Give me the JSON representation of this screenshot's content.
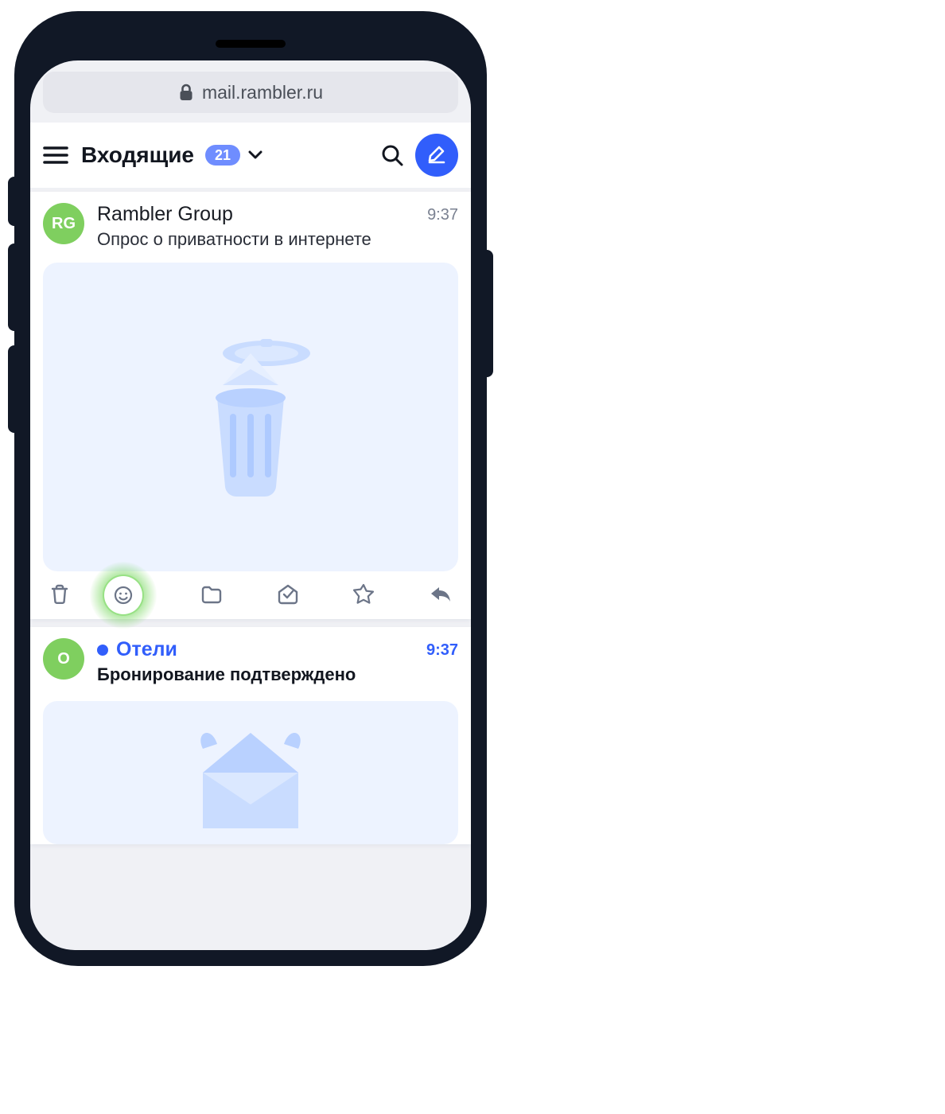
{
  "browser": {
    "url": "mail.rambler.ru"
  },
  "header": {
    "folder": "Входящие",
    "unread_count": "21"
  },
  "messages": [
    {
      "avatar_initials": "RG",
      "avatar_color": "green",
      "sender": "Rambler Group",
      "time": "9:37",
      "subject": "Опрос о приватности в интернете",
      "unread": false,
      "preview": "trash"
    },
    {
      "avatar_initials": "O",
      "avatar_color": "green",
      "sender": "Отели",
      "time": "9:37",
      "subject": "Бронирование подтверждено",
      "unread": true,
      "preview": "viking"
    }
  ],
  "actions": {
    "highlighted": "emoji"
  },
  "colors": {
    "accent": "#315efb",
    "badge": "#6f8dff",
    "highlight": "#5ed040"
  }
}
